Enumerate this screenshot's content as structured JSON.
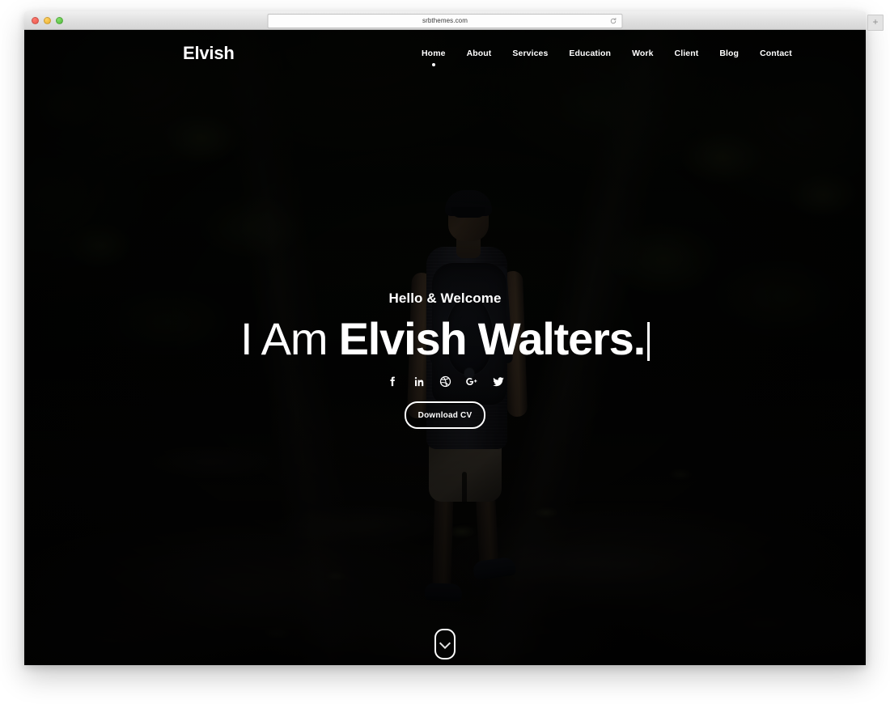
{
  "browser": {
    "url": "srbthemes.com",
    "reload_icon": "reload-icon",
    "new_tab_label": "+",
    "traffic_lights": [
      {
        "name": "close",
        "color": "#e8574c"
      },
      {
        "name": "minimize",
        "color": "#e9ae2e"
      },
      {
        "name": "maximize",
        "color": "#53b83c"
      }
    ]
  },
  "site": {
    "brand": "Elvish",
    "nav": [
      {
        "label": "Home",
        "active": true
      },
      {
        "label": "About",
        "active": false
      },
      {
        "label": "Services",
        "active": false
      },
      {
        "label": "Education",
        "active": false
      },
      {
        "label": "Work",
        "active": false
      },
      {
        "label": "Client",
        "active": false
      },
      {
        "label": "Blog",
        "active": false
      },
      {
        "label": "Contact",
        "active": false
      }
    ],
    "hero": {
      "greeting": "Hello & Welcome",
      "headline_prefix": "I Am ",
      "headline_name": "Elvish Walters.",
      "cta_label": "Download CV",
      "social": [
        {
          "name": "facebook-icon",
          "label": "f"
        },
        {
          "name": "linkedin-icon",
          "label": "in"
        },
        {
          "name": "dribbble-icon",
          "label": "dribbble"
        },
        {
          "name": "google-plus-icon",
          "label": "G+"
        },
        {
          "name": "twitter-icon",
          "label": "twitter"
        }
      ],
      "scroll_hint": "scroll-down"
    },
    "colors": {
      "text": "#ffffff",
      "overlay": "#000000",
      "background": "#0a0c09"
    }
  }
}
